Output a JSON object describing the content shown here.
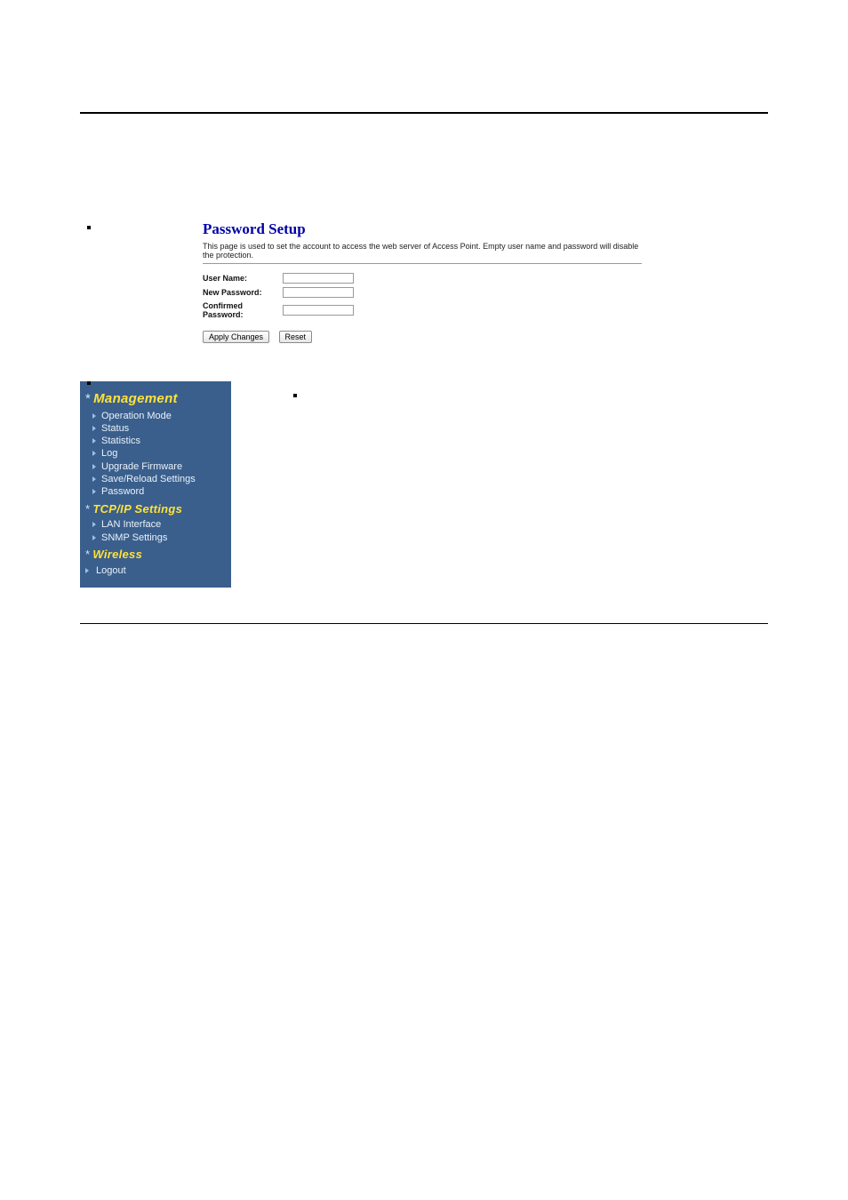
{
  "bullets_top": [
    "",
    "",
    "",
    ""
  ],
  "password_setup": {
    "title": "Password Setup",
    "description": "This page is used to set the account to access the web server of Access Point. Empty user name and password will disable the protection.",
    "labels": {
      "user": "User Name:",
      "newpw": "New Password:",
      "confirm": "Confirmed Password:"
    },
    "values": {
      "user": "",
      "newpw": "",
      "confirm": ""
    },
    "buttons": {
      "apply": "Apply Changes",
      "reset": "Reset"
    }
  },
  "bullets_mid": [
    "",
    "",
    ""
  ],
  "sidebar": {
    "sections": [
      {
        "title": "Management",
        "items": [
          "Operation Mode",
          "Status",
          "Statistics",
          "Log",
          "Upgrade Firmware",
          "Save/Reload Settings",
          "Password"
        ]
      },
      {
        "title": "TCP/IP Settings",
        "items": [
          "LAN Interface",
          "SNMP Settings"
        ]
      },
      {
        "title": "Wireless",
        "items": []
      }
    ],
    "logout": "Logout"
  }
}
